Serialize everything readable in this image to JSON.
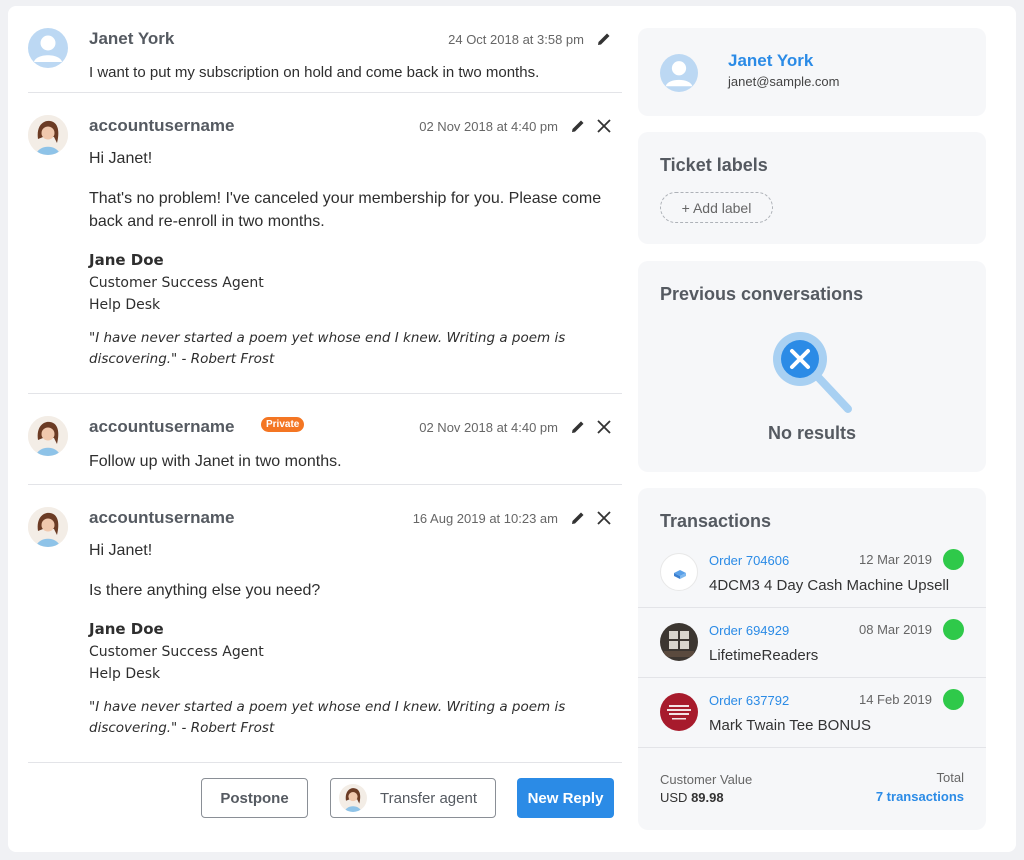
{
  "messages": [
    {
      "author": "Janet York",
      "date": "24 Oct 2018 at 3:58 pm",
      "text": "I want to put my subscription on hold and come back in two months."
    },
    {
      "author": "accountusername",
      "date": "02 Nov 2018 at 4:40 pm",
      "greeting": "Hi Janet!",
      "text": "That's no problem! I've canceled your membership for you. Please come back and re-enroll in two months.",
      "signature": {
        "name": "Jane Doe",
        "role": "Customer Success Agent",
        "team": "Help Desk",
        "quote": "\"I have never started a poem yet whose end I knew. Writing a poem is discovering.\" - Robert Frost"
      }
    },
    {
      "author": "accountusername",
      "badge": "Private",
      "date": "02 Nov 2018 at 4:40 pm",
      "text": "Follow up with Janet in two months."
    },
    {
      "author": "accountusername",
      "date": "16 Aug 2019 at 10:23 am",
      "greeting": "Hi Janet!",
      "text": "Is there anything else you need?",
      "signature": {
        "name": "Jane Doe",
        "role": "Customer Success Agent",
        "team": "Help Desk",
        "quote": "\"I have never started a poem yet whose end I knew. Writing a poem is discovering.\" - Robert Frost"
      }
    }
  ],
  "actions": {
    "postpone": "Postpone",
    "transfer": "Transfer agent",
    "new_reply": "New Reply"
  },
  "customer": {
    "name": "Janet York",
    "email": "janet@sample.com"
  },
  "labels": {
    "title": "Ticket labels",
    "add": "+ Add label"
  },
  "previous": {
    "title": "Previous conversations",
    "empty": "No results"
  },
  "transactions": {
    "title": "Transactions",
    "items": [
      {
        "order": "Order 704606",
        "date": "12 Mar 2019",
        "name": "4DCM3 4 Day Cash Machine Upsell",
        "status": "green"
      },
      {
        "order": "Order 694929",
        "date": "08 Mar 2019",
        "name": "LifetimeReaders",
        "status": "green"
      },
      {
        "order": "Order 637792",
        "date": "14 Feb 2019",
        "name": "Mark Twain Tee BONUS",
        "status": "green"
      }
    ],
    "customer_value_label": "Customer Value",
    "currency": "USD",
    "value": "89.98",
    "total_label": "Total",
    "total_link": "7 transactions"
  },
  "colors": {
    "accent": "#2b8be6",
    "private_badge": "#f47623",
    "status_ok": "#2fc94a"
  }
}
